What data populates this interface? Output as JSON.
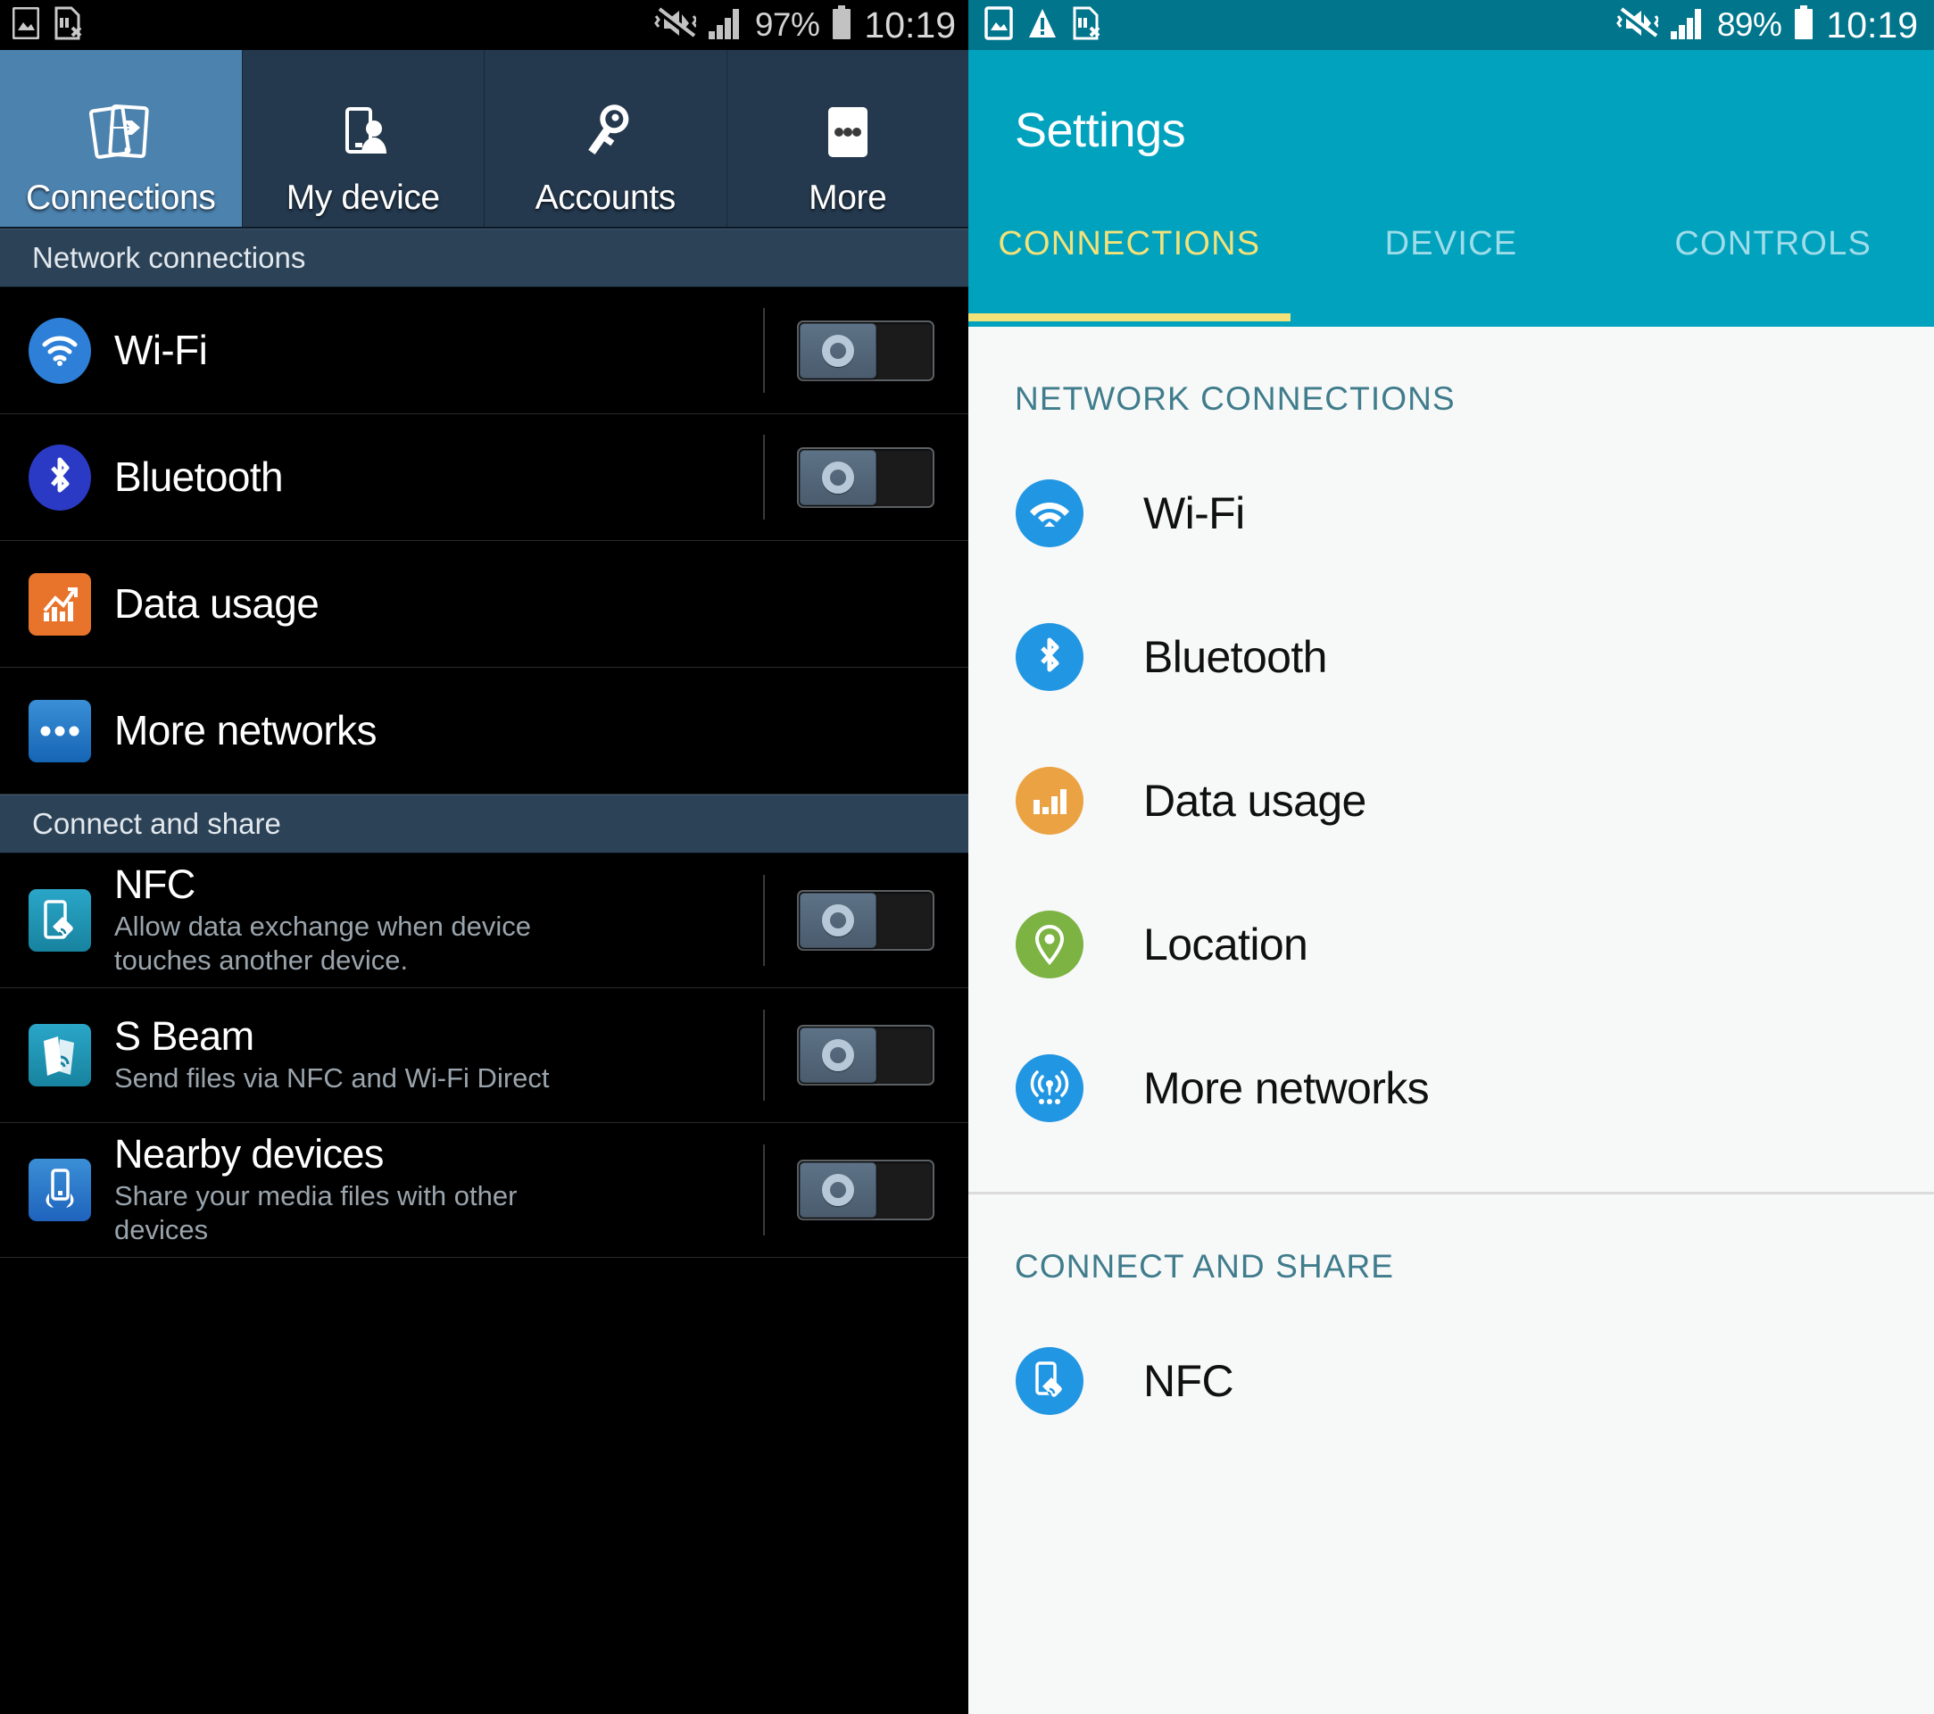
{
  "colors": {
    "left_status_bg": "#000000",
    "left_tab_active": "#4c82ae",
    "left_tab_inactive": "#24394e",
    "left_section_header": "#2b4257",
    "right_status_bg": "#00758c",
    "right_appbar_bg": "#00a2bd",
    "right_tab_active": "#f3e27a",
    "right_tab_inactive": "#9fdcea",
    "right_section_label": "#3f7c8c",
    "icon_blue": "#2196e3",
    "icon_orange": "#eba242",
    "icon_green": "#7cb342",
    "icon_bluetooth_dark": "#2a3ac4",
    "icon_data_orange": "#e8732a",
    "icon_teal": "#1a91b5"
  },
  "left_panel": {
    "statusbar": {
      "icons": [
        "image-icon",
        "sim-card-error-icon"
      ],
      "mute_icon": "vibrate-mute-icon",
      "signal_icon": "signal-bars-icon",
      "battery_percent": "97%",
      "battery_icon": "battery-full-icon",
      "time": "10:19"
    },
    "tabs": [
      {
        "label": "Connections",
        "icon": "connections-icon",
        "active": true
      },
      {
        "label": "My device",
        "icon": "my-device-icon",
        "active": false
      },
      {
        "label": "Accounts",
        "icon": "accounts-key-icon",
        "active": false
      },
      {
        "label": "More",
        "icon": "more-dots-icon",
        "active": false
      }
    ],
    "sections": [
      {
        "header": "Network connections",
        "rows": [
          {
            "title": "Wi-Fi",
            "desc": "",
            "icon": "wifi-icon",
            "icon_color": "#2d7fd8",
            "icon_shape": "circle",
            "toggle": true,
            "toggle_state": "off"
          },
          {
            "title": "Bluetooth",
            "desc": "",
            "icon": "bluetooth-icon",
            "icon_color": "#2a3ac4",
            "icon_shape": "circle",
            "toggle": true,
            "toggle_state": "off"
          },
          {
            "title": "Data usage",
            "desc": "",
            "icon": "data-usage-icon",
            "icon_color": "#e8732a",
            "icon_shape": "square",
            "toggle": false
          },
          {
            "title": "More networks",
            "desc": "",
            "icon": "more-networks-icon",
            "icon_color": "#1d72c4",
            "icon_shape": "square",
            "toggle": false
          }
        ]
      },
      {
        "header": "Connect and share",
        "rows": [
          {
            "title": "NFC",
            "desc": "Allow data exchange when device touches another device.",
            "icon": "nfc-icon",
            "icon_color": "#1a91b5",
            "icon_shape": "square",
            "toggle": true,
            "toggle_state": "off"
          },
          {
            "title": "S Beam",
            "desc": "Send files via NFC and Wi-Fi Direct",
            "icon": "s-beam-icon",
            "icon_color": "#1a91b5",
            "icon_shape": "square",
            "toggle": true,
            "toggle_state": "off"
          },
          {
            "title": "Nearby devices",
            "desc": "Share your media files with other devices",
            "icon": "nearby-devices-icon",
            "icon_color": "#2a6fd0",
            "icon_shape": "square",
            "toggle": true,
            "toggle_state": "off"
          }
        ]
      }
    ]
  },
  "right_panel": {
    "statusbar": {
      "icons": [
        "image-icon",
        "warning-icon",
        "sim-card-error-icon"
      ],
      "mute_icon": "vibrate-mute-icon",
      "signal_icon": "signal-bars-icon",
      "battery_percent": "89%",
      "battery_icon": "battery-full-icon",
      "time": "10:19"
    },
    "app_title": "Settings",
    "tabs": [
      {
        "label": "CONNECTIONS",
        "active": true
      },
      {
        "label": "DEVICE",
        "active": false
      },
      {
        "label": "CONTROLS",
        "active": false
      }
    ],
    "sections": [
      {
        "header": "NETWORK CONNECTIONS",
        "rows": [
          {
            "title": "Wi-Fi",
            "icon": "wifi-icon",
            "icon_color": "#2196e3"
          },
          {
            "title": "Bluetooth",
            "icon": "bluetooth-icon",
            "icon_color": "#2196e3"
          },
          {
            "title": "Data usage",
            "icon": "data-usage-icon",
            "icon_color": "#eba242"
          },
          {
            "title": "Location",
            "icon": "location-pin-icon",
            "icon_color": "#7cb342"
          },
          {
            "title": "More networks",
            "icon": "more-networks-icon",
            "icon_color": "#2196e3"
          }
        ]
      },
      {
        "header": "CONNECT AND SHARE",
        "rows": [
          {
            "title": "NFC",
            "icon": "nfc-icon",
            "icon_color": "#2196e3"
          }
        ]
      }
    ]
  }
}
